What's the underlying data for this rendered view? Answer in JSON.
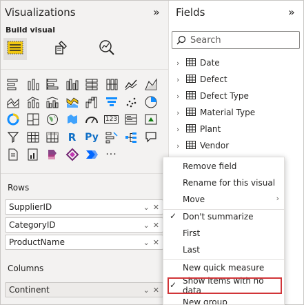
{
  "colors": {
    "accent": "#f2c811",
    "highlight": "#d13438",
    "blue": "#118dff"
  },
  "visualizations": {
    "title": "Visualizations",
    "collapse_glyph": "»",
    "build_visual_label": "Build visual",
    "build_tabs": [
      "build-visual-icon",
      "format-visual-icon",
      "analytics-icon"
    ],
    "gallery_icons": [
      "stacked-bar-icon",
      "stacked-column-icon",
      "clustered-bar-icon",
      "clustered-column-icon",
      "100-bar-icon",
      "100-column-icon",
      "line-chart-icon",
      "area-chart-icon",
      "stacked-area-icon",
      "line-column-icon",
      "line-clustered-column-icon",
      "ribbon-chart-icon",
      "waterfall-icon",
      "funnel-icon",
      "scatter-icon",
      "pie-chart-icon",
      "donut-chart-icon",
      "treemap-icon",
      "map-icon",
      "filled-map-icon",
      "gauge-icon",
      "card-icon",
      "multirow-card-icon",
      "kpi-icon",
      "slicer-icon",
      "table-icon",
      "matrix-icon",
      "r-visual-icon",
      "python-visual-icon",
      "key-influencers-icon",
      "decomposition-tree-icon",
      "qa-icon",
      "paginated-report-icon",
      "smart-narrative-icon",
      "power-apps-icon",
      "power-automate-icon",
      "arcgis-icon",
      "more-visuals-icon"
    ],
    "gallery_glyphs": {
      "r": "R",
      "python": "Py",
      "card": "123",
      "more": "···"
    },
    "rows_label": "Rows",
    "rows": [
      "SupplierID",
      "CategoryID",
      "ProductName"
    ],
    "columns_label": "Columns",
    "columns": [
      "Continent"
    ],
    "well_chevron": "⌄",
    "well_close": "✕"
  },
  "fields": {
    "title": "Fields",
    "collapse_glyph": "»",
    "search_placeholder": "Search",
    "tables": [
      "Date",
      "Defect",
      "Defect Type",
      "Material Type",
      "Plant",
      "Vendor"
    ],
    "expand_glyph": "›"
  },
  "context_menu": {
    "items": [
      {
        "label": "Remove field"
      },
      {
        "label": "Rename for this visual"
      },
      {
        "label": "Move",
        "submenu_glyph": "›"
      },
      {
        "label": "Don't summarize",
        "check_glyph": "✓"
      },
      {
        "label": "First"
      },
      {
        "label": "Last"
      },
      {
        "label": "New quick measure"
      },
      {
        "label": "Show items with no data",
        "check_glyph": "✓"
      },
      {
        "label": "New group"
      }
    ]
  }
}
